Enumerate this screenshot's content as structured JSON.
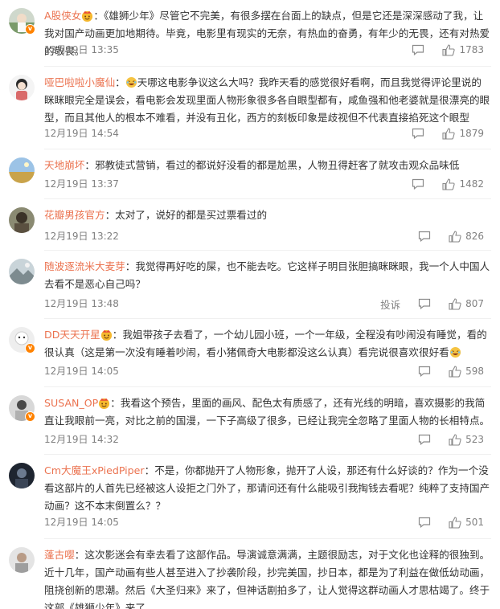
{
  "comments": [
    {
      "user": "A股侠女",
      "badge": "crown-emoji",
      "text": "：《雄狮少年》尽管它不完美，有很多摆在台面上的缺点，但是它还是深深感动了我，让我对国产动画更加地期待。毕竟，电影里有现实的无奈，有热血的奋勇，有年少的无畏，还有对热爱的敬畏。",
      "time": "12月19日 13:35",
      "likes": "1783"
    },
    {
      "user": "哑巴啦啦小魔仙",
      "badge": "laughing-emoji",
      "text": "天哪这电影争议这么大吗？我昨天看的感觉很好看啊，而且我觉得评论里说的眯眯眼完全是误会，看电影会发现里面人物形象很多各自眼型都有，咸鱼强和他老婆就是很漂亮的眼型，而且其他人的根本不难看，并没有丑化，西方的刻板印象是歧视但不代表直接掐死这个眼型",
      "time": "12月19日 14:54",
      "likes": "1879"
    },
    {
      "user": "天地崩坏",
      "badge": "",
      "text": "：邪教徒式营销，看过的都说好没看的都是尬黑，人物丑得赶客了就攻击观众品味低",
      "time": "12月19日 13:37",
      "likes": "1482"
    },
    {
      "user": "花瓣男孩官方",
      "badge": "",
      "text": "：太对了，说好的都是买过票看过的",
      "time": "12月19日 13:22",
      "likes": "826"
    },
    {
      "user": "随波逐流米大麦芽",
      "badge": "",
      "text": "：我觉得再好吃的屎，也不能去吃。它这样子明目张胆搞眯眯眼，我一个人中国人去看不是恶心自己吗？",
      "time": "12月19日 13:48",
      "likes": "807",
      "report": "投诉"
    },
    {
      "user": "DD天天开星",
      "badge": "crown-emoji",
      "text": "：我姐带孩子去看了，一个幼儿园小班，一个一年级，全程没有吵闹没有睡觉，看的很认真（这是第一次没有睡着吵闹，看小猪佩奇大电影都没这么认真）看完说很喜欢很好看",
      "trailing_emoji": "laughing-emoji",
      "time": "12月19日 14:05",
      "likes": "598"
    },
    {
      "user": "SUSAN_OP",
      "badge": "crown-emoji",
      "text": "：我看这个预告，里面的画风、配色太有质感了，还有光线的明暗，喜欢摄影的我简直让我眼前一亮，对比之前的国漫，一下子高级了很多，已经让我完全忽略了里面人物的长相特点。",
      "time": "12月19日 14:32",
      "likes": "523"
    },
    {
      "user": "Cm大魔王xPiedPiper",
      "badge": "",
      "text": "：不是，你都抛开了人物形象，抛开了人设，那还有什么好谈的？作为一个没看这部片的人首先已经被这人设拒之门外了，那请问还有什么能吸引我掏钱去看呢？纯粹了支持国产动画？这不本末倒置么？？",
      "time": "12月19日 14:05",
      "likes": "501"
    },
    {
      "user": "蓬古嘤",
      "badge": "",
      "text": "：这次影迷会有幸去看了这部作品。导演诚意满满，主题很励志，对于文化也诠释的很独到。近十几年，国产动画有些人甚至进入了抄袭阶段，抄完美国，抄日本，都是为了利益在做低幼动画，阻挠创新的思潮。然后《大圣归来》来了，但神话剧拍多了，让人觉得这群动画人才思枯竭了。终于这部《雄狮少年》来了",
      "time": "",
      "likes": ""
    }
  ],
  "colors": {
    "username": "#eb7350",
    "text": "#333333",
    "meta": "#808080",
    "divider": "#f0f0f0",
    "vip": "#ff8200"
  }
}
